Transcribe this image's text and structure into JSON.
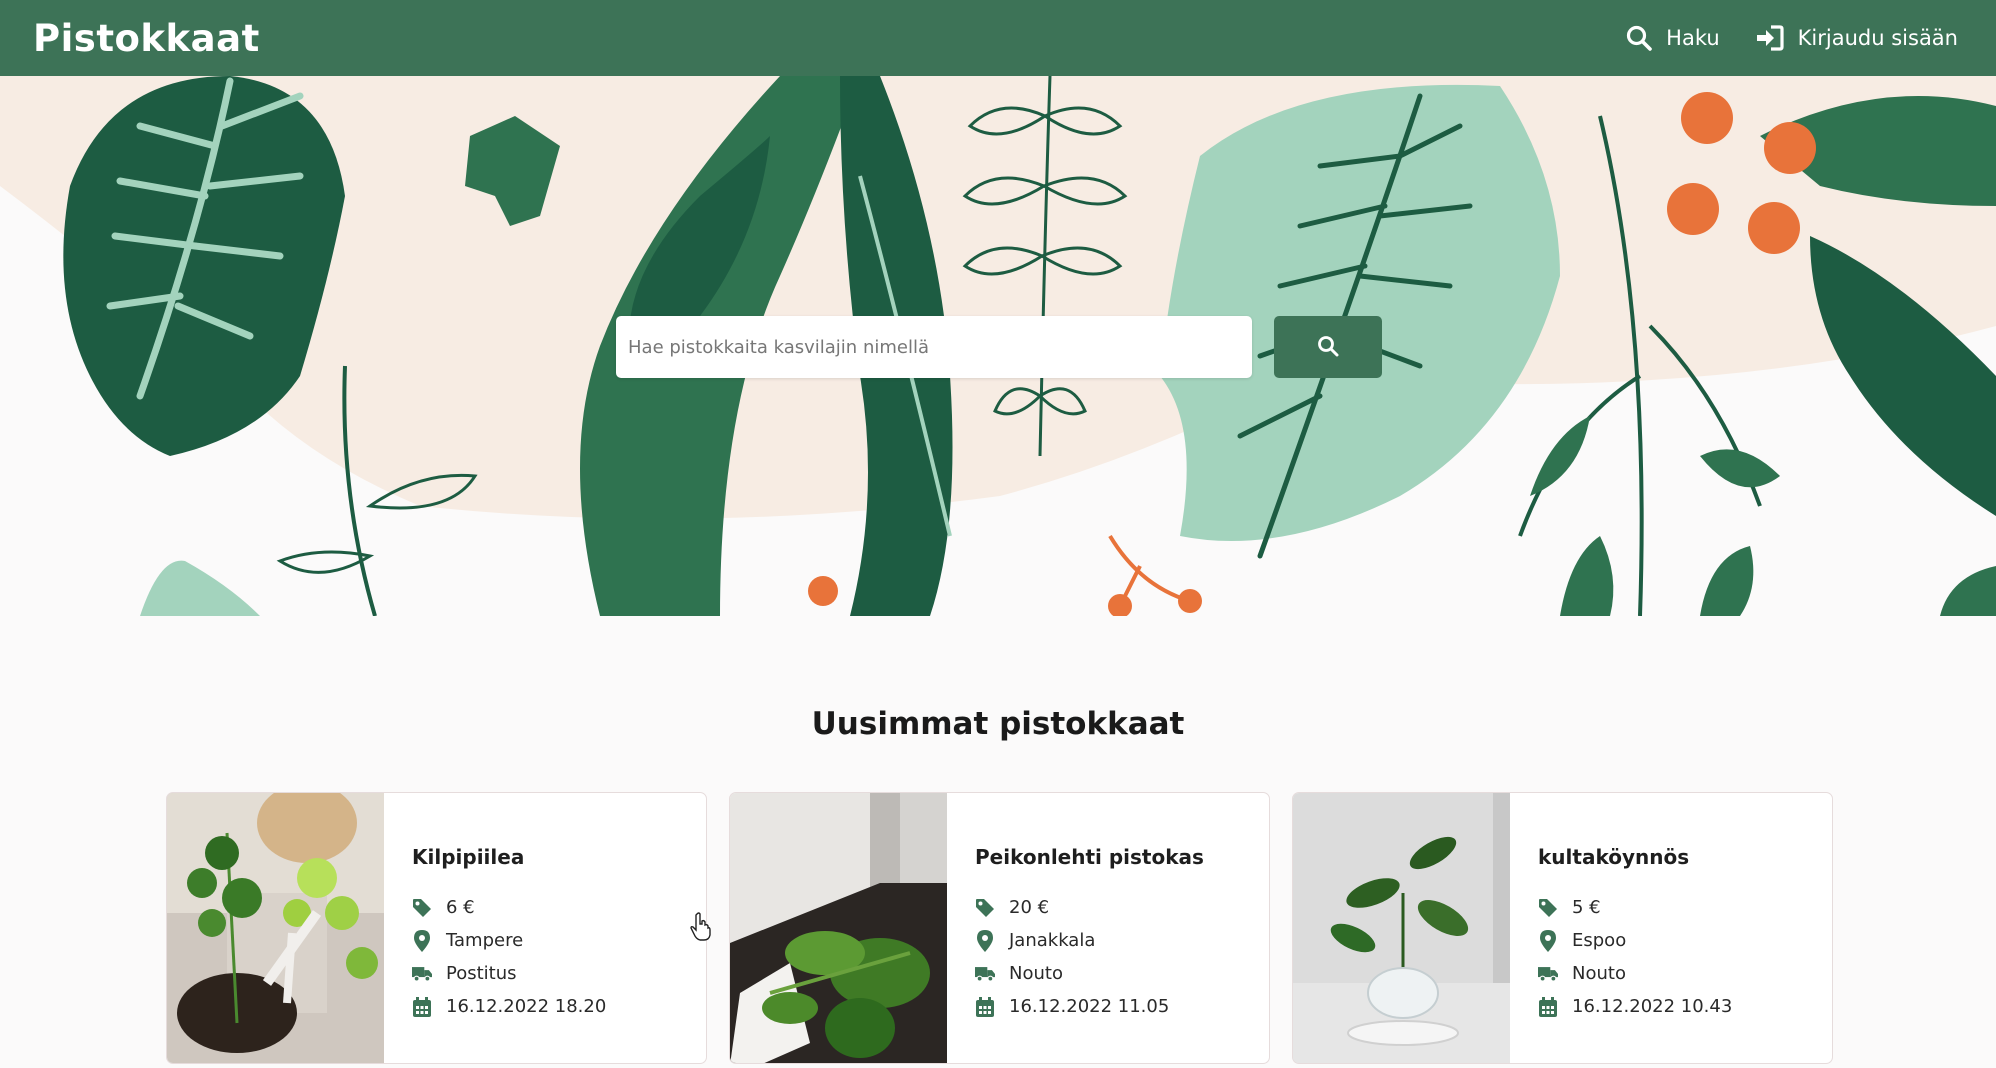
{
  "navbar": {
    "brand": "Pistokkaat",
    "search_link": "Haku",
    "login_link": "Kirjaudu sisään"
  },
  "hero": {
    "search_placeholder": "Hae pistokkaita kasvilajin nimellä"
  },
  "section": {
    "title": "Uusimmat pistokkaat"
  },
  "listings": [
    {
      "title": "Kilpipiilea",
      "price": "6 €",
      "location": "Tampere",
      "delivery": "Postitus",
      "date": "16.12.2022 18.20"
    },
    {
      "title": "Peikonlehti pistokas",
      "price": "20 €",
      "location": "Janakkala",
      "delivery": "Nouto",
      "date": "16.12.2022 11.05"
    },
    {
      "title": "kultaköynnös",
      "price": "5 €",
      "location": "Espoo",
      "delivery": "Nouto",
      "date": "16.12.2022 10.43"
    }
  ],
  "colors": {
    "primary": "#3d7357",
    "dark_leaf": "#1d5c42",
    "mid_leaf": "#2f7350",
    "light_leaf": "#a3d3bd",
    "berry": "#e8733a",
    "cream": "#f7ece3"
  },
  "icons": {
    "search": "search-icon",
    "login": "sign-in-icon",
    "price": "tag-icon",
    "location": "map-marker-icon",
    "delivery": "truck-icon",
    "date": "calendar-icon"
  }
}
